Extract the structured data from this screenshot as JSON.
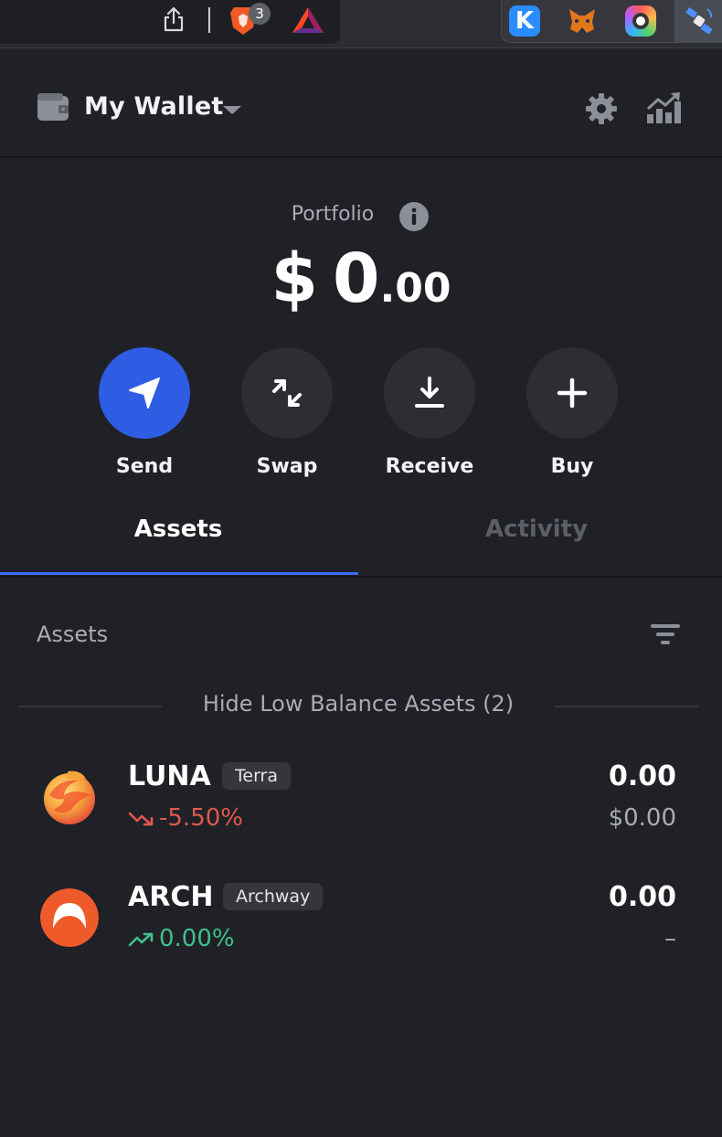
{
  "browser": {
    "brave_badge": "3",
    "extension_k_letter": "K"
  },
  "header": {
    "wallet_name": "My Wallet"
  },
  "portfolio": {
    "label": "Portfolio",
    "currency": "$",
    "integer": "0",
    "decimal": ".00"
  },
  "actions": [
    {
      "label": "Send",
      "icon": "send-icon"
    },
    {
      "label": "Swap",
      "icon": "swap-icon"
    },
    {
      "label": "Receive",
      "icon": "download-icon"
    },
    {
      "label": "Buy",
      "icon": "plus-icon"
    }
  ],
  "tabs": [
    {
      "label": "Assets",
      "active": true
    },
    {
      "label": "Activity",
      "active": false
    }
  ],
  "assets_section": {
    "title": "Assets",
    "hide_low_balance": "Hide Low Balance Assets (2)"
  },
  "assets": [
    {
      "symbol": "LUNA",
      "chain": "Terra",
      "change": "-5.50%",
      "trend": "down",
      "amount": "0.00",
      "value": "$0.00"
    },
    {
      "symbol": "ARCH",
      "chain": "Archway",
      "change": "0.00%",
      "trend": "up",
      "amount": "0.00",
      "value": "–"
    }
  ],
  "colors": {
    "accent": "#2e5de4",
    "tab_underline": "#3b6df0",
    "negative": "#e0584f",
    "positive": "#3fbf8a",
    "background": "#1f2126"
  }
}
